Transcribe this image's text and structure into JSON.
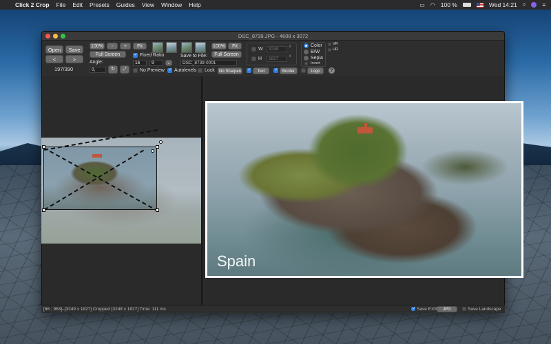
{
  "menubar": {
    "app_name": "Click 2 Crop",
    "items": [
      "File",
      "Edit",
      "Presets",
      "Guides",
      "View",
      "Window",
      "Help"
    ],
    "battery": "100 %",
    "clock": "Wed 14:21"
  },
  "window": {
    "title": "DSC_8739.JPG - 4608 x 3072"
  },
  "toolbar": {
    "open": "Open",
    "save": "Save",
    "prev": "<",
    "next": ">",
    "counter": "197/390",
    "zoom_100": "100%",
    "zoom_minus": "-",
    "zoom_plus": "+",
    "zoom_fit": "Fit",
    "full_screen": "Full Screen",
    "fixed_ratio": "Fixed Ratio",
    "angle_label": "Angle:",
    "angle_value": "0,",
    "ratio_w": "16",
    "ratio_h": "9",
    "no_preview": "No Preview",
    "autolevels": "Autolevels",
    "lock": "Lock",
    "no_sharpen": "No Sharpen",
    "save_to_file": "Save to File:",
    "filename": "DSC_8739-0001",
    "preview_100": "100%",
    "preview_fit": "Fit",
    "preview_full_screen": "Full Screen",
    "w_label": "W",
    "w_value": "3248",
    "h_label": "H",
    "h_value": "1827",
    "color": "Color",
    "bw": "B/W",
    "sepia": "Sepia",
    "invert": "Invert",
    "vr": "VR",
    "hr": "HR",
    "text": "Text",
    "border": "Border",
    "logo": "Logo",
    "help": "?"
  },
  "preview": {
    "watermark": "Spain"
  },
  "status": {
    "info": "[86 ; 963]–[3249 x 1827]  Cropped [3248 x 1827]  Time: 111 ms",
    "save_exif": "Save EXIF",
    "format": "JPG",
    "save_landscape": "Save Landscape"
  }
}
